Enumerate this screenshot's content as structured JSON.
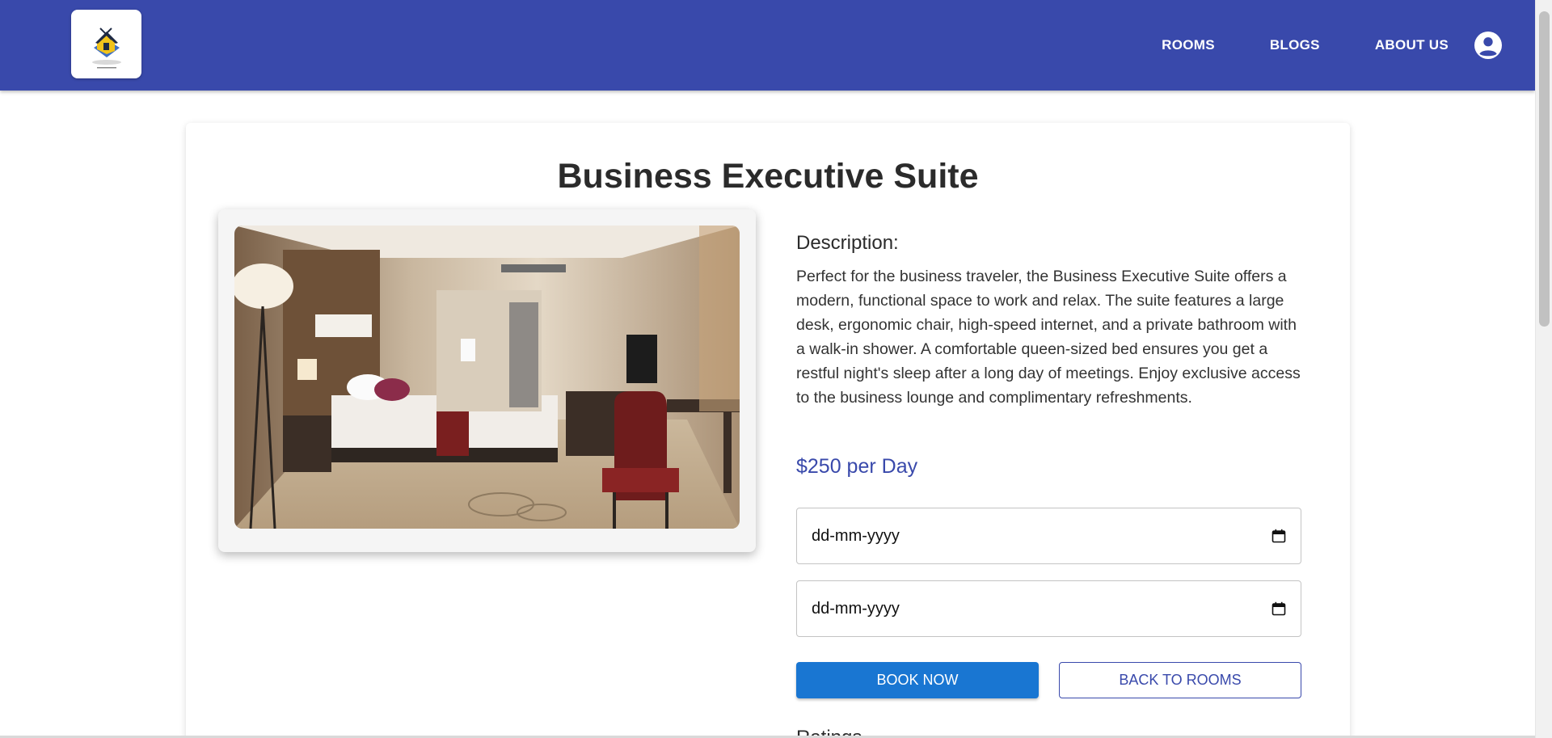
{
  "header": {
    "logo_alt": "logo",
    "nav": [
      "ROOMS",
      "BLOGS",
      "ABOUT US"
    ],
    "brand_color": "#3949ab",
    "account_icon": "account-circle-icon"
  },
  "room": {
    "title": "Business Executive Suite",
    "image_name": "hotel-room-photo",
    "description_label": "Description:",
    "description": "Perfect for the business traveler, the Business Executive Suite offers a modern, functional space to work and relax. The suite features a large desk, ergonomic chair, high-speed internet, and a private bathroom with a walk-in shower. A comfortable queen-sized bed ensures you get a restful night's sleep after a long day of meetings. Enjoy exclusive access to the business lounge and complimentary refreshments.",
    "price": "$250 per Day",
    "price_color": "#3949ab"
  },
  "booking": {
    "checkin_placeholder": "dd-mm-yyyy",
    "checkout_placeholder": "dd-mm-yyyy",
    "book_label": "BOOK NOW",
    "back_label": "BACK TO ROOMS",
    "book_color": "#1976d2"
  },
  "ratings_label": "Ratings"
}
